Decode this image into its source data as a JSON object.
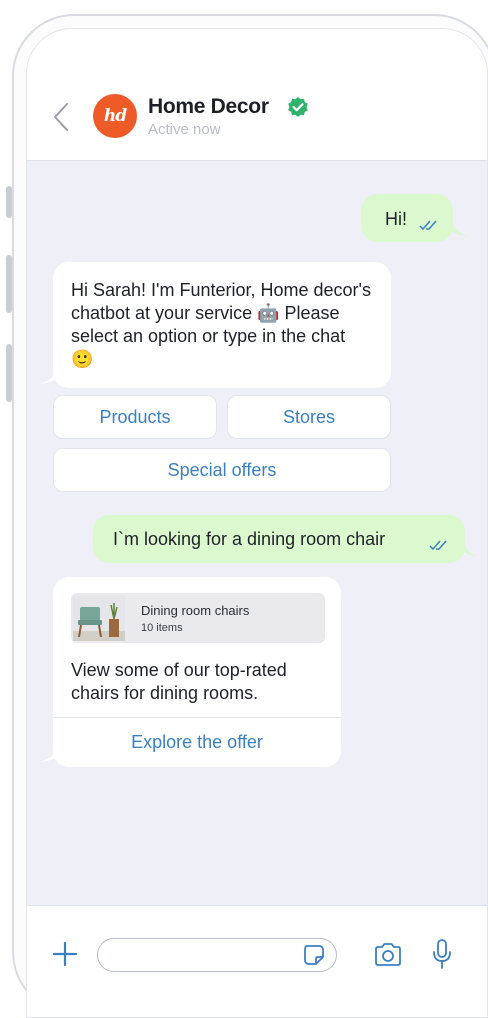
{
  "header": {
    "back_icon": "chevron-left-icon",
    "avatar_initials": "hd",
    "title": "Home Decor",
    "verified_icon": "verified-badge-icon",
    "status": "Active now"
  },
  "messages": {
    "greeting_sent": "Hi!",
    "bot_intro": "Hi Sarah! I'm Funterior, Home decor's chatbot at your service 🤖 Please select an option or type in the chat 🙂",
    "request_sent": "I`m looking for a dining room chair"
  },
  "options": {
    "products": "Products",
    "stores": "Stores",
    "special_offers": "Special offers"
  },
  "card": {
    "title": "Dining room chairs",
    "subtitle": "10 items",
    "text": "View some of our top-rated chairs for dining rooms.",
    "link": "Explore the offer"
  },
  "composer": {
    "input_value": "",
    "input_placeholder": "",
    "icons": [
      "plus-icon",
      "sticker-icon",
      "camera-icon",
      "microphone-icon"
    ]
  },
  "colors": {
    "accent_blue": "#3a7fc1",
    "sent_bubble": "#dcf8cf",
    "chat_background": "#eeeff7",
    "avatar": "#ee5a28",
    "verified": "#2fb36d",
    "ticks": "#3a7fc1"
  }
}
